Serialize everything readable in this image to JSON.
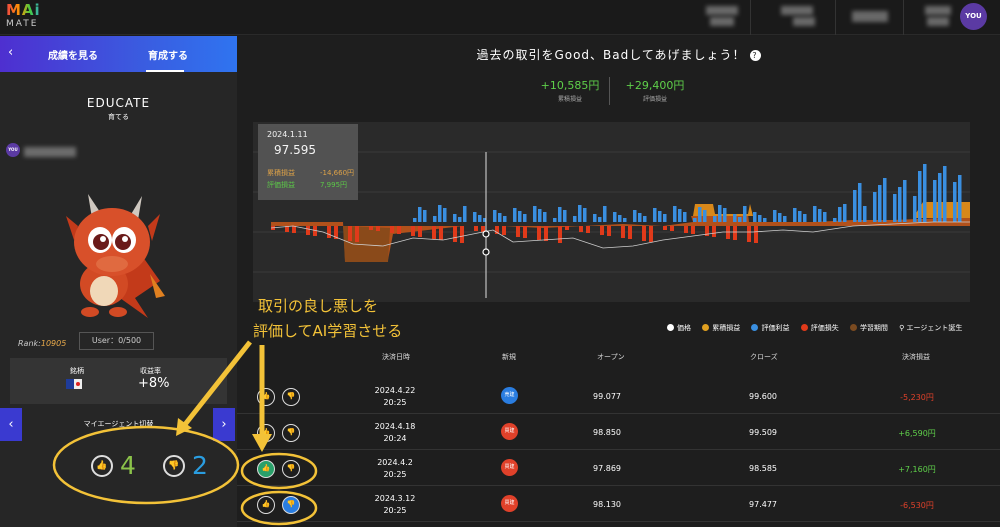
{
  "header": {
    "logo_line1": "MAi",
    "logo_line2": "MATE",
    "avatar_label": "YOU"
  },
  "left": {
    "back_icon": "chevron-left-icon",
    "tabs": [
      {
        "label": "成績を見る"
      },
      {
        "label": "育成する"
      }
    ],
    "title": "EDUCATE",
    "subtitle": "育てる",
    "avatar_label": "YOU",
    "rank_prefix": "Rank:",
    "rank_value": "10905",
    "user_label": "User：0/500",
    "stat_headers": [
      "銘柄",
      "収益率"
    ],
    "profit_rate": "+8%",
    "switch_label": "マイエージェント切替",
    "good_count": "4",
    "bad_count": "2"
  },
  "main": {
    "title": "過去の取引をGood、Badしてあげましょう！",
    "cumulative_pnl": "+10,585円",
    "cumulative_pnl_label": "累積損益",
    "valuation_pnl": "+29,400円",
    "valuation_pnl_label": "評価損益",
    "tooltip": {
      "date": "2024.1.11",
      "price": "97.595",
      "row1_label": "累積損益",
      "row1_value": "-14,660円",
      "row2_label": "評価損益",
      "row2_value": "7,995円"
    },
    "legend": [
      {
        "label": "価格",
        "color": "#ffffff"
      },
      {
        "label": "累積損益",
        "color": "#e0a020"
      },
      {
        "label": "評価利益",
        "color": "#3a8fe0"
      },
      {
        "label": "評価損失",
        "color": "#e03a1a"
      },
      {
        "label": "学習期間",
        "color": "#7a4a20"
      },
      {
        "label": "エージェント誕生",
        "color": "#ffffff"
      }
    ],
    "table": {
      "headers": [
        "決済日時",
        "新規",
        "オープン",
        "クローズ",
        "決済損益"
      ],
      "rows": [
        {
          "date": "2024.4.22",
          "time": "20:25",
          "side": "売建",
          "side_color": "#2a7de0",
          "open": "99.077",
          "close": "99.600",
          "pnl": "-5,230円",
          "pnl_color": "#e0412a",
          "good": false,
          "bad": false
        },
        {
          "date": "2024.4.18",
          "time": "20:24",
          "side": "買建",
          "side_color": "#e0412a",
          "open": "98.850",
          "close": "99.509",
          "pnl": "+6,590円",
          "pnl_color": "#5fd04a",
          "good": false,
          "bad": false
        },
        {
          "date": "2024.4.2",
          "time": "20:25",
          "side": "買建",
          "side_color": "#e0412a",
          "open": "97.869",
          "close": "98.585",
          "pnl": "+7,160円",
          "pnl_color": "#5fd04a",
          "good": true,
          "bad": false
        },
        {
          "date": "2024.3.12",
          "time": "20:25",
          "side": "買建",
          "side_color": "#e0412a",
          "open": "98.130",
          "close": "97.477",
          "pnl": "-6,530円",
          "pnl_color": "#e0412a",
          "good": false,
          "bad": true
        }
      ]
    }
  },
  "annotation": {
    "line1": "取引の良し悪しを",
    "line2": "評価してAI学習させる",
    "color": "#f3c238"
  },
  "colors": {
    "accent_purple": "#4e2fd0",
    "good_green": "#2aa06a",
    "bad_blue": "#2a7de0"
  }
}
